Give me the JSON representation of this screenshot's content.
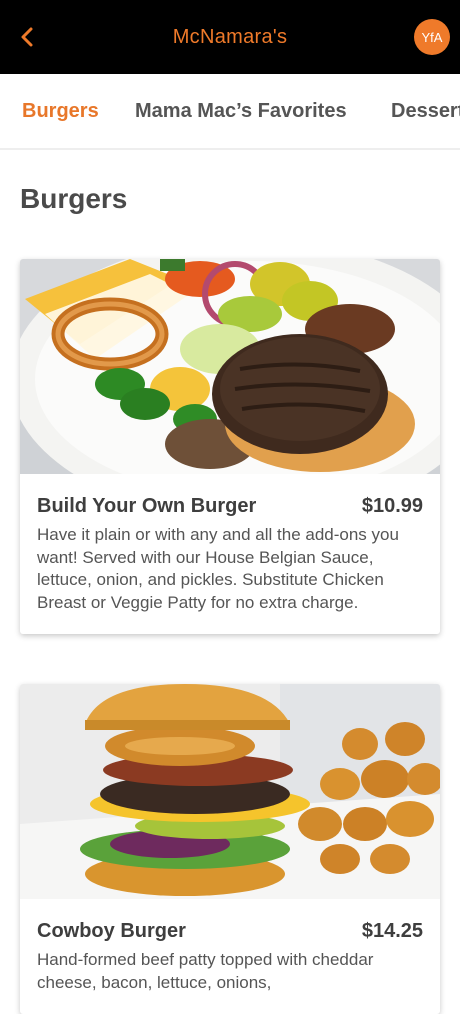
{
  "header": {
    "title": "McNamara's",
    "avatar_initials": "YfA",
    "accent": "#ef7a2a"
  },
  "tabs": [
    {
      "label": "Burgers",
      "active": true
    },
    {
      "label": "Mama Mac’s Favorites",
      "active": false
    },
    {
      "label": "Desserts",
      "active": false
    }
  ],
  "section": {
    "title": "Burgers"
  },
  "items": [
    {
      "name": "Build Your Own Burger",
      "price": "$10.99",
      "description": "Have it plain or with any and all the add-ons you want! Served with our House Belgian Sauce, lettuce, onion, and pickles. Substitute Chicken Breast or Veggie Patty for no extra charge."
    },
    {
      "name": "Cowboy Burger",
      "price": "$14.25",
      "description": "Hand-formed beef patty topped with cheddar cheese, bacon, lettuce, onions,"
    }
  ]
}
